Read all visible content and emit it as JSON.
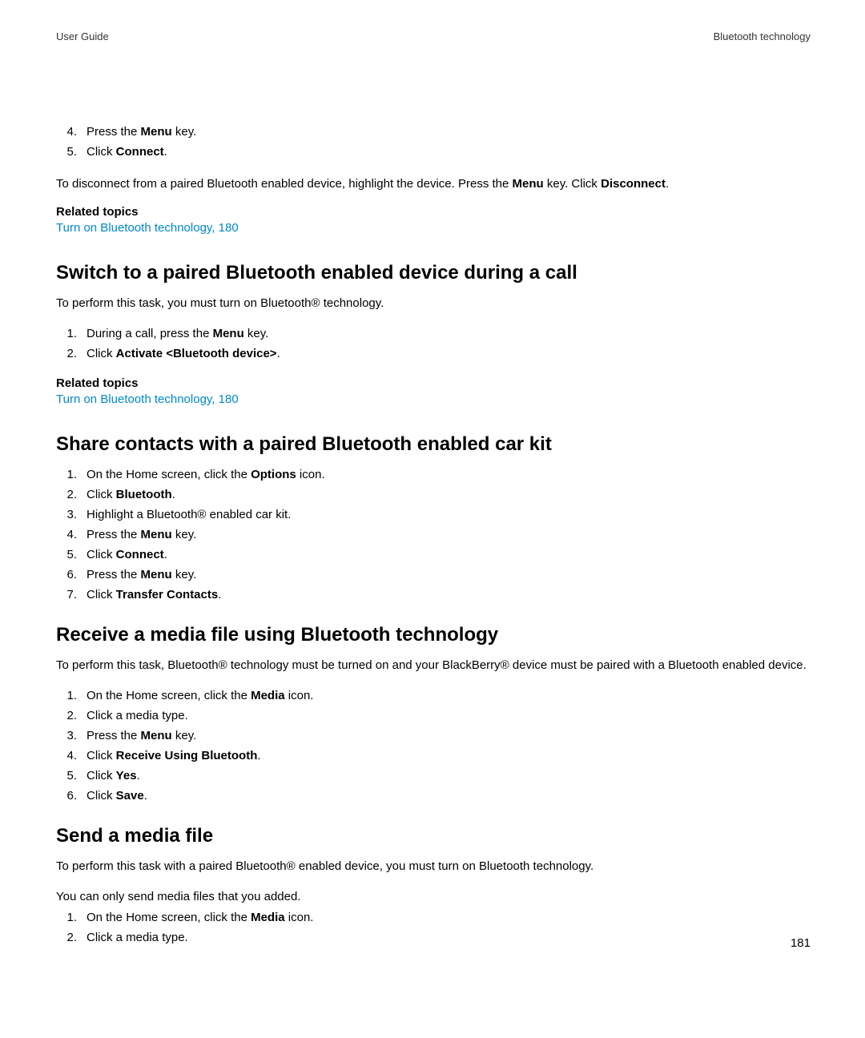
{
  "header": {
    "left": "User Guide",
    "right": "Bluetooth technology"
  },
  "intro_list": {
    "item4_num": "4.",
    "item4_pre": "Press the ",
    "item4_bold": "Menu",
    "item4_post": " key.",
    "item5_num": "5.",
    "item5_pre": "Click ",
    "item5_bold": "Connect",
    "item5_post": "."
  },
  "disconnect": {
    "pre": "To disconnect from a paired Bluetooth enabled device, highlight the device. Press the ",
    "bold1": "Menu",
    "mid": " key. Click ",
    "bold2": "Disconnect",
    "post": "."
  },
  "related_topics_heading": "Related topics",
  "related_link": "Turn on Bluetooth technology, 180",
  "section1": {
    "title": "Switch to a paired Bluetooth enabled device during a call",
    "intro": "To perform this task, you must turn on Bluetooth® technology.",
    "item1_num": "1.",
    "item1_pre": "During a call, press the ",
    "item1_bold": "Menu",
    "item1_post": " key.",
    "item2_num": "2.",
    "item2_pre": "Click ",
    "item2_bold": "Activate <Bluetooth device>",
    "item2_post": "."
  },
  "section2": {
    "title": "Share contacts with a paired Bluetooth enabled car kit",
    "item1_num": "1.",
    "item1_pre": "On the Home screen, click the ",
    "item1_bold": "Options",
    "item1_post": " icon.",
    "item2_num": "2.",
    "item2_pre": "Click ",
    "item2_bold": "Bluetooth",
    "item2_post": ".",
    "item3_num": "3.",
    "item3_text": "Highlight a Bluetooth® enabled car kit.",
    "item4_num": "4.",
    "item4_pre": "Press the ",
    "item4_bold": "Menu",
    "item4_post": " key.",
    "item5_num": "5.",
    "item5_pre": "Click ",
    "item5_bold": "Connect",
    "item5_post": ".",
    "item6_num": "6.",
    "item6_pre": "Press the ",
    "item6_bold": "Menu",
    "item6_post": " key.",
    "item7_num": "7.",
    "item7_pre": "Click ",
    "item7_bold": "Transfer Contacts",
    "item7_post": "."
  },
  "section3": {
    "title": "Receive a media file using Bluetooth technology",
    "intro": "To perform this task, Bluetooth® technology must be turned on and your BlackBerry® device must be paired with a Bluetooth enabled device.",
    "item1_num": "1.",
    "item1_pre": "On the Home screen, click the ",
    "item1_bold": "Media",
    "item1_post": " icon.",
    "item2_num": "2.",
    "item2_text": "Click a media type.",
    "item3_num": "3.",
    "item3_pre": "Press the ",
    "item3_bold": "Menu",
    "item3_post": " key.",
    "item4_num": "4.",
    "item4_pre": "Click ",
    "item4_bold": "Receive Using Bluetooth",
    "item4_post": ".",
    "item5_num": "5.",
    "item5_pre": "Click ",
    "item5_bold": "Yes",
    "item5_post": ".",
    "item6_num": "6.",
    "item6_pre": "Click ",
    "item6_bold": "Save",
    "item6_post": "."
  },
  "section4": {
    "title": "Send a media file",
    "intro1": "To perform this task with a paired Bluetooth® enabled device, you must turn on Bluetooth technology.",
    "intro2": "You can only send media files that you added.",
    "item1_num": "1.",
    "item1_pre": "On the Home screen, click the ",
    "item1_bold": "Media",
    "item1_post": " icon.",
    "item2_num": "2.",
    "item2_text": "Click a media type."
  },
  "page_number": "181"
}
